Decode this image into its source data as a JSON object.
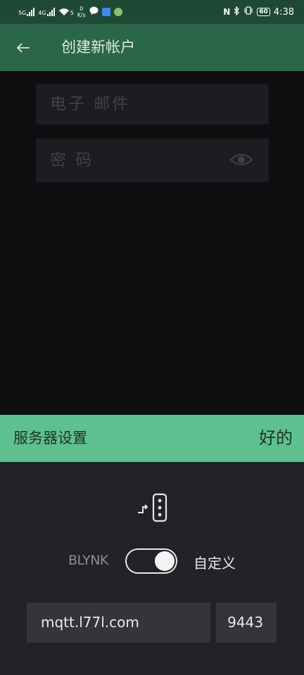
{
  "status_bar": {
    "sim1_type": "5G",
    "sim2_type": "4G",
    "wifi_type": "5",
    "speed_value": "0",
    "speed_unit": "K/s",
    "battery": "60",
    "time": "4:38"
  },
  "app_bar": {
    "back_icon": "arrow-left-icon",
    "title": "创建新帐户"
  },
  "form": {
    "email_placeholder": "电子 邮件",
    "password_placeholder": "密 码",
    "password_toggle_icon": "eye-icon"
  },
  "server_settings": {
    "title": "服务器设置",
    "ok_label": "好的",
    "server_icon": "server-icon",
    "toggle_left_label": "BLYNK",
    "toggle_right_label": "自定义",
    "toggle_on": true,
    "host_value": "mqtt.l77l.com",
    "port_value": "9443"
  },
  "colors": {
    "app_bar": "#2a6648",
    "accent": "#5dc08e",
    "sheet_bg": "#222328",
    "input_bg": "#34353b"
  }
}
